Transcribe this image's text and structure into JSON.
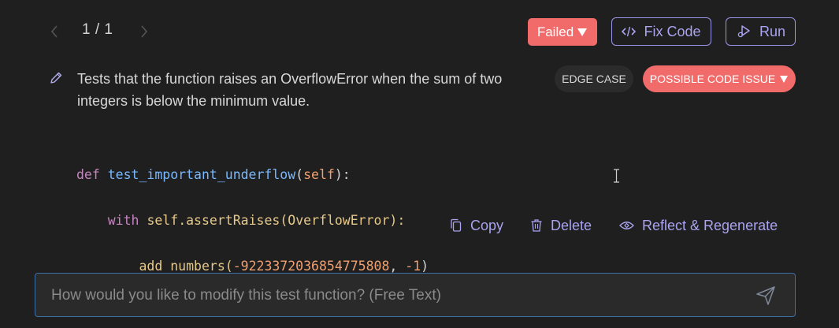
{
  "pager": {
    "text": "1 / 1"
  },
  "header": {
    "status_label": "Failed",
    "fix_code_label": "Fix Code",
    "run_label": "Run"
  },
  "test": {
    "description": "Tests that the function raises an OverflowError when the sum of two integers is below the minimum value.",
    "tags": {
      "edge_case": "EDGE CASE",
      "possible_issue": "POSSIBLE CODE ISSUE"
    },
    "code": {
      "line1": {
        "kw": "def",
        "name": "test_important_underflow",
        "open": "(",
        "param": "self",
        "close": "):"
      },
      "line2": {
        "kw": "with",
        "obj": "self",
        "call": ".assertRaises(OverflowError):"
      },
      "line3": {
        "call": "add_numbers(",
        "arg1": "-9223372036854775808",
        "sep": ", ",
        "arg2": "-1",
        "close": ")"
      }
    }
  },
  "actions": {
    "copy": "Copy",
    "delete": "Delete",
    "reflect": "Reflect & Regenerate"
  },
  "modify_input": {
    "placeholder": "How would you like to modify this test function? (Free Text)",
    "value": ""
  },
  "colors": {
    "background": "#1f1f1f",
    "accent": "#a9a3f0",
    "danger": "#f26b6b",
    "input_border": "#3d6ea5"
  }
}
